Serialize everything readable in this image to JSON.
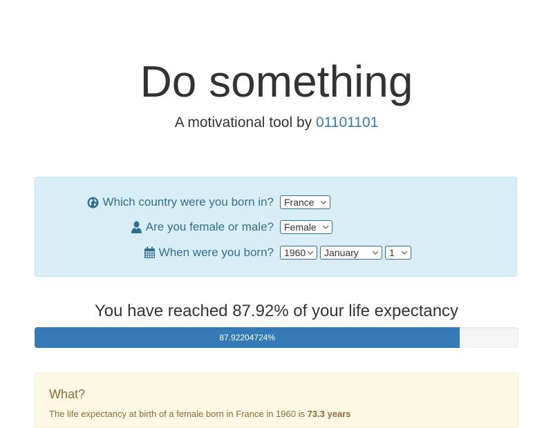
{
  "header": {
    "title": "Do something",
    "subtitle_prefix": "A motivational tool by",
    "author_link": "01101101"
  },
  "form": {
    "country": {
      "icon": "globe-icon",
      "label": "Which country were you born in?",
      "selected": "France"
    },
    "sex": {
      "icon": "user-icon",
      "label": "Are you female or male?",
      "selected": "Female"
    },
    "birth": {
      "icon": "calendar-icon",
      "label": "When were you born?",
      "year": "1960",
      "month": "January",
      "day": "1"
    }
  },
  "progress": {
    "title": "You have reached 87.92% of your life expectancy",
    "bar_label": "87.92204724%",
    "value": 0.8792204724
  },
  "what": {
    "heading": "What?",
    "text_prefix": "The life expectancy at birth of a female born in France in 1960 is",
    "text_value": "73.3 years"
  },
  "colors": {
    "link": "#337ab7",
    "info_bg": "#d9edf7",
    "info_text": "#31708f",
    "progress_bar": "#337ab7",
    "warning_bg": "#fcf8e3",
    "warning_text": "#8a6d3b"
  }
}
